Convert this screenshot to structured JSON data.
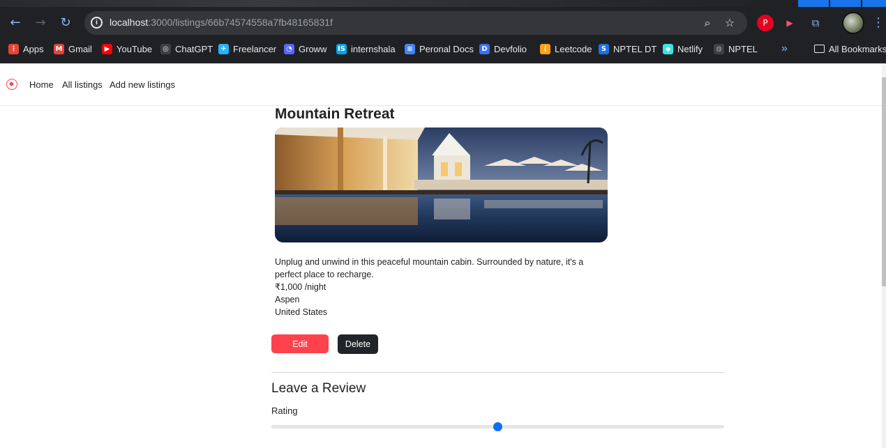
{
  "browser": {
    "url_host": "localhost",
    "url_path": ":3000/listings/66b74574558a7fb48165831f",
    "bookmarks": [
      {
        "label": "Apps",
        "icon": "apps-grid-icon",
        "color": "#ea4335"
      },
      {
        "label": "Gmail",
        "icon": "gmail-icon",
        "color": "#ea4335"
      },
      {
        "label": "YouTube",
        "icon": "youtube-icon",
        "color": "#ff0000"
      },
      {
        "label": "ChatGPT",
        "icon": "chatgpt-icon",
        "color": "#e8eaed"
      },
      {
        "label": "Freelancer",
        "icon": "freelancer-icon",
        "color": "#29b2fe"
      },
      {
        "label": "Groww",
        "icon": "groww-icon",
        "color": "#5367ff"
      },
      {
        "label": "internshala",
        "icon": "internshala-icon",
        "color": "#00a5ec"
      },
      {
        "label": "Peronal Docs",
        "icon": "docs-icon",
        "color": "#4285f4"
      },
      {
        "label": "Devfolio",
        "icon": "devfolio-icon",
        "color": "#3770ff"
      },
      {
        "label": "Leetcode",
        "icon": "leetcode-icon",
        "color": "#ffa116"
      },
      {
        "label": "NPTEL DT",
        "icon": "nptel-icon",
        "color": "#1a73e8"
      },
      {
        "label": "Netlify",
        "icon": "netlify-icon",
        "color": "#32e6e2"
      },
      {
        "label": "NPTEL",
        "icon": "globe-icon",
        "color": "#9aa0a6"
      }
    ],
    "more_bookmarks": "»",
    "all_bookmarks": "All Bookmarks"
  },
  "navbar": {
    "brand_icon": "compass-icon",
    "links": [
      "Home",
      "All listings",
      "Add new listings"
    ]
  },
  "listing": {
    "title": "Mountain Retreat",
    "description": "Unplug and unwind in this peaceful mountain cabin. Surrounded by nature, it's a perfect place to recharge.",
    "price": "₹1,000 /night",
    "location": "Aspen",
    "country": "United States",
    "edit_label": "Edit",
    "delete_label": "Delete"
  },
  "review": {
    "heading": "Leave a Review",
    "rating_label": "Rating",
    "rating_fraction": 0.5
  },
  "colors": {
    "accent": "#fe424d",
    "dark_button": "#212529",
    "slider": "#0d6efd"
  }
}
